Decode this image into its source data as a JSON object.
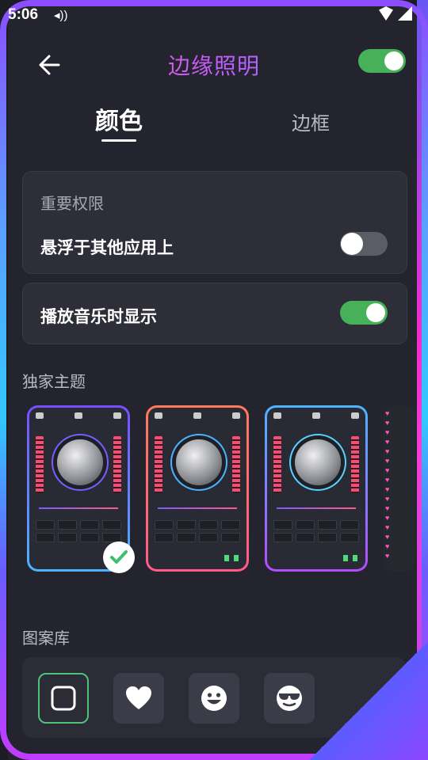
{
  "status_bar": {
    "time": "5:06"
  },
  "header": {
    "title": "边缘照明",
    "master_toggle_on": true
  },
  "tabs": [
    {
      "label": "颜色",
      "selected": true
    },
    {
      "label": "边框",
      "selected": false
    }
  ],
  "permissions": {
    "title": "重要权限",
    "overlay_label": "悬浮于其他应用上",
    "overlay_on": false
  },
  "music_row": {
    "label": "播放音乐时显示",
    "on": true
  },
  "themes_section": {
    "label": "独家主题",
    "themes": [
      {
        "name": "theme-1",
        "border_colors": [
          "#7a4dff",
          "#4db3ff"
        ],
        "selected": true
      },
      {
        "name": "theme-2",
        "border_colors": [
          "#ff7a5a",
          "#ff5a8a"
        ],
        "selected": false
      },
      {
        "name": "theme-3",
        "border_colors": [
          "#4db3ff",
          "#b44bff"
        ],
        "selected": false
      }
    ]
  },
  "pattern_section": {
    "label": "图案库",
    "patterns": [
      {
        "icon": "square-icon",
        "selected": true
      },
      {
        "icon": "heart-icon",
        "selected": false
      },
      {
        "icon": "smiley-icon",
        "selected": false
      },
      {
        "icon": "sunglasses-smiley-icon",
        "selected": false
      }
    ]
  },
  "colors": {
    "accent_green": "#47b15a",
    "background": "#23242d",
    "card": "#2d2e38"
  }
}
